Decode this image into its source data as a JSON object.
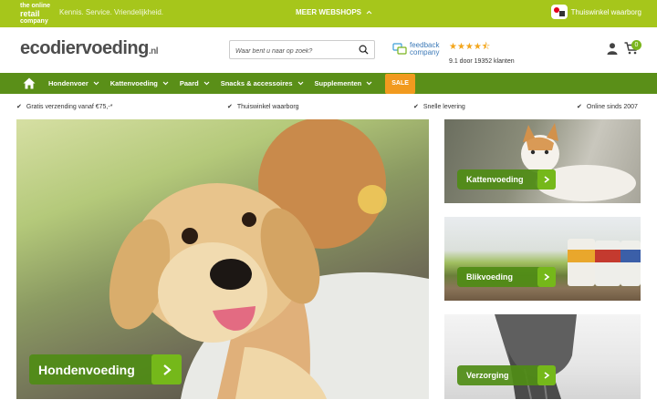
{
  "topbar": {
    "retail_logo": [
      "the online",
      "retail",
      "company"
    ],
    "tagline": "Kennis. Service. Vriendelijkheid.",
    "webshops_label": "MEER WEBSHOPS",
    "trust_label": "Thuiswinkel waarborg"
  },
  "header": {
    "logo_main": "ecodiervoeding",
    "logo_suffix": ".nl",
    "search_placeholder": "Waar bent u naar op zoek?",
    "feedback_line1": "feedback",
    "feedback_line2": "company",
    "rating_value": 4.5,
    "rating_text": "9.1 door 19352 klanten",
    "cart_count": "0"
  },
  "nav": {
    "items": [
      "Hondenvoer",
      "Kattenvoeding",
      "Paard",
      "Snacks & accessoires",
      "Supplementen"
    ],
    "sale_label": "SALE"
  },
  "usps": [
    "Gratis verzending vanaf €75,-*",
    "Thuiswinkel waarborg",
    "Snelle levering",
    "Online sinds 2007"
  ],
  "hero": {
    "label": "Hondenvoeding"
  },
  "tiles": [
    "Kattenvoeding",
    "Blikvoeding",
    "Verzorging"
  ],
  "colors": {
    "brand_green": "#a6c61b",
    "nav_green": "#5a8f18",
    "cta_green": "#4f8c15",
    "sale_orange": "#f19a1e",
    "star": "#f3a61c"
  }
}
